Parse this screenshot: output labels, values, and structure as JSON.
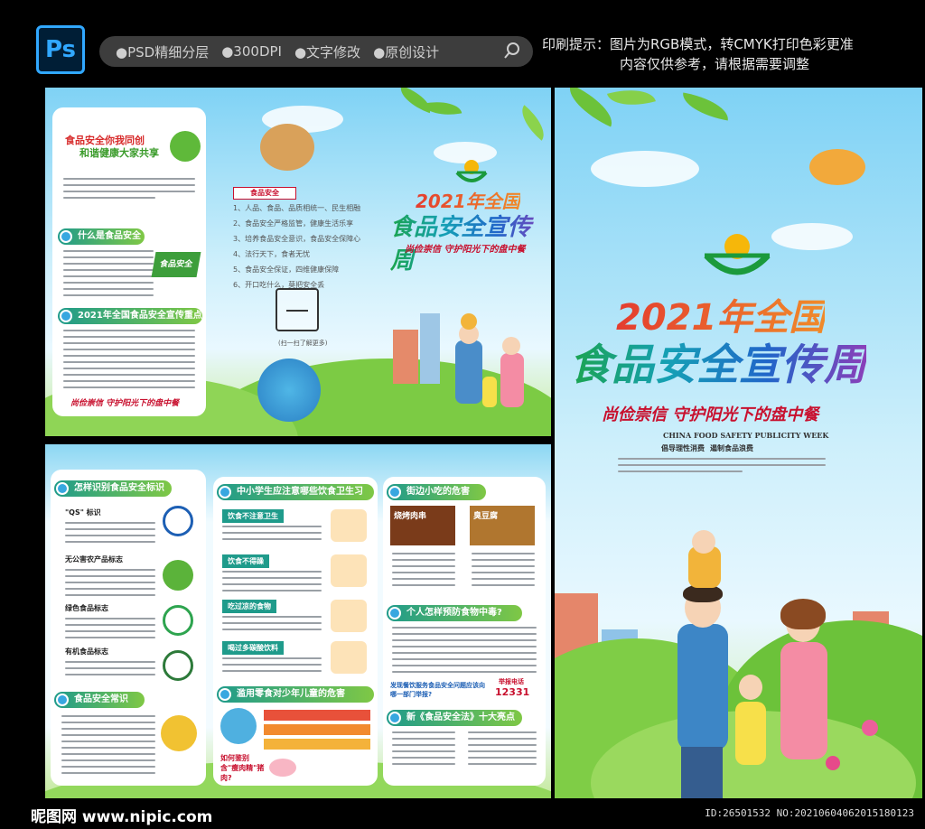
{
  "topbar": {
    "app_icon": "Ps",
    "features": [
      "●PSD精细分层",
      "●300DPI",
      "●文字修改",
      "●原创设计"
    ],
    "print_tip_line1": "印刷提示：图片为RGB模式，转CMYK打印色彩更准",
    "print_tip_line2": "内容仅供参考，请根据需要调整"
  },
  "cover": {
    "year_title": "2021年全国",
    "main_title": "食品安全宣传周",
    "slogan": "尚俭崇信 守护阳光下的盘中餐",
    "english": "CHINA FOOD SAFETY PUBLICITY WEEK",
    "tag1": "倡导理性消费",
    "tag2": "遏制食品浪费"
  },
  "inner_top": {
    "headline_line1": "食品安全你我同创",
    "headline_line2": "和谐健康大家共享",
    "section1": "什么是食品安全",
    "section2": "2021年全国食品安全宣传重点",
    "slogan": "尚俭崇信  守护阳光下的盘中餐",
    "food_safety_label": "食品安全",
    "checklist": [
      "1、人品、食品、品质相统一、民生相融",
      "2、食品安全严格监管，健康生活乐享",
      "3、培养食品安全意识，食品安全保障心",
      "4、法行天下，食者无忧",
      "5、食品安全保证，四维健康保障",
      "6、开口吃什么，莫把安全丢"
    ],
    "qr_caption": "(扫一扫了解更多)",
    "mid_year_title": "2021年全国",
    "mid_main_title": "食品安全宣传周",
    "mid_slogan": "尚俭崇信 守护阳光下的盘中餐"
  },
  "inner_bottom": {
    "col1_head": "怎样识别食品安全标识",
    "col1_items": [
      "\"QS\" 标识",
      "无公害农产品标志",
      "绿色食品标志",
      "有机食品标志"
    ],
    "col1_head2": "食品安全常识",
    "col2_head": "中小学生应注意哪些饮食卫生习惯?",
    "col2_items": [
      "饮食不注意卫生",
      "饮食不得躁",
      "吃过凉的食物",
      "喝过多碳酸饮料"
    ],
    "col2_head2": "滥用零食对少年儿童的危害",
    "col2_bottom": "如何鉴别含\"瘦肉精\"猪肉?",
    "col3_head": "街边小吃的危害",
    "food_labels": [
      "烧烤肉串",
      "臭豆腐"
    ],
    "col3_head2": "个人怎样预防食物中毒?",
    "hotline_question": "发现餐饮服务食品安全问题应该向哪一部门举报?",
    "hotline_label": "举报电话",
    "hotline_number": "12331",
    "col3_head3": "新《食品安全法》十大亮点"
  },
  "footer": {
    "brand": "昵图网 www.nipic.com",
    "ids": "ID:26501532 NO:20210604062015180123"
  },
  "colors": {
    "accent_green": "#1f9b8b",
    "title_red": "#e43d2f",
    "slogan_red": "#c8102e",
    "ps_blue": "#31a8ff"
  }
}
